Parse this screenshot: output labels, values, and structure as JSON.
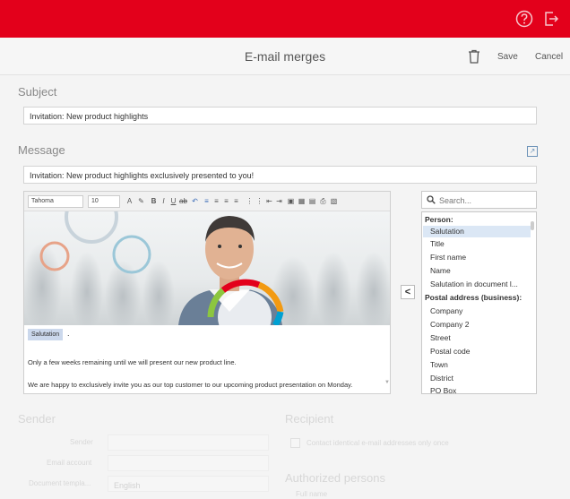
{
  "header": {
    "title": "E-mail merges",
    "save_label": "Save",
    "cancel_label": "Cancel",
    "accent_color": "#e3001b"
  },
  "subject": {
    "label": "Subject",
    "value": "Invitation: New product highlights"
  },
  "message": {
    "label": "Message",
    "value": "Invitation: New product highlights exclusively presented to you!"
  },
  "editor": {
    "font": "Tahoma",
    "size": "10",
    "salutation_tag": "Salutation",
    "after_tag": ".",
    "lines": [
      "Only a few weeks remaining until we will present our new product line.",
      "We are happy to exclusively invite you as our top customer to our upcoming product presentation on Monday."
    ]
  },
  "insert_button": "<",
  "field_search": {
    "placeholder": "Search..."
  },
  "field_list": [
    {
      "label": "Person:",
      "group": true
    },
    {
      "label": "Salutation",
      "selected": true
    },
    {
      "label": "Title"
    },
    {
      "label": "First name"
    },
    {
      "label": "Name"
    },
    {
      "label": "Salutation in document l..."
    },
    {
      "label": "Postal address (business):",
      "group": true
    },
    {
      "label": "Company"
    },
    {
      "label": "Company 2"
    },
    {
      "label": "Street"
    },
    {
      "label": "Postal code"
    },
    {
      "label": "Town"
    },
    {
      "label": "District"
    },
    {
      "label": "PO Box"
    }
  ],
  "sender_section": {
    "label": "Sender",
    "sender_label": "Sender",
    "email_account_label": "Email account",
    "document_template_label": "Document templa...",
    "document_template_value": "English"
  },
  "recipient_section": {
    "label": "Recipient",
    "contact_checkbox_label": "Contact identical e-mail addresses only once",
    "authorized_label": "Authorized persons",
    "full_name_label": "Full name"
  }
}
